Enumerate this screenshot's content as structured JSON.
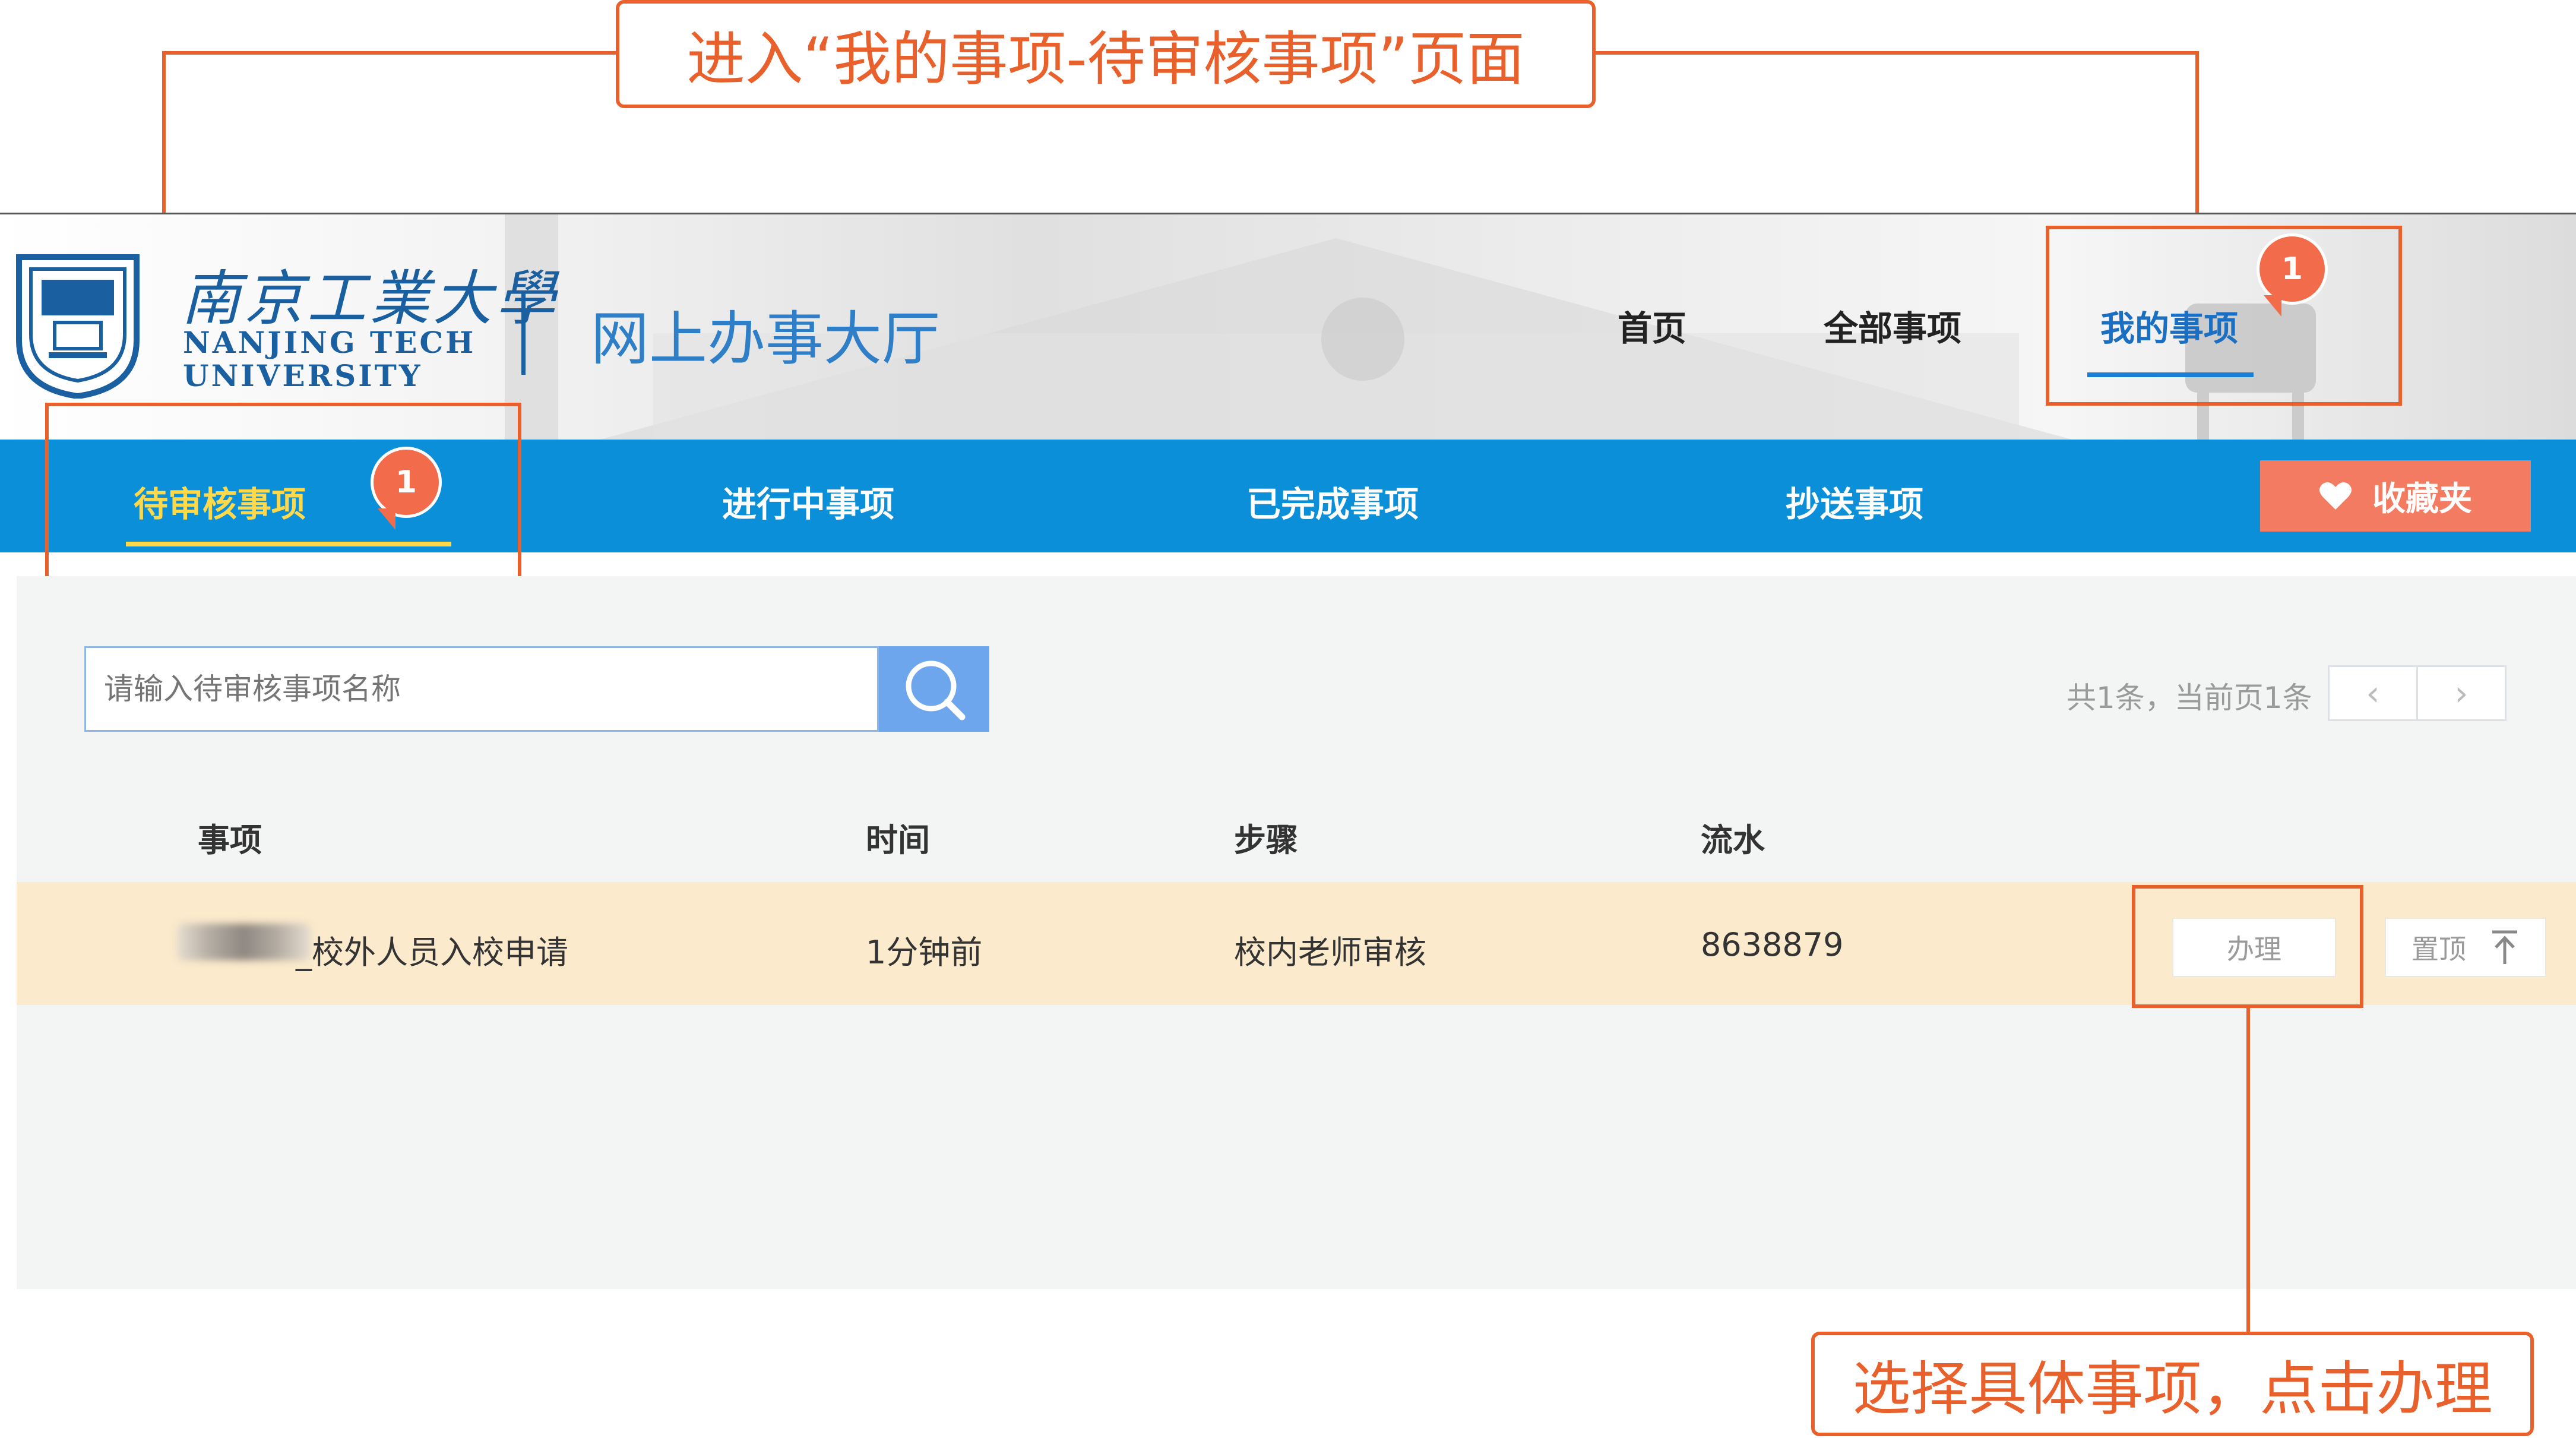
{
  "annotations": {
    "top": "进入“我的事项-待审核事项”页面",
    "bottom": "选择具体事项，点击办理"
  },
  "header": {
    "logo_cn": "南京工業大學",
    "logo_en_line1": "NANJING TECH",
    "logo_en_line2": "UNIVERSITY",
    "hall_title": "网上办事大厅",
    "nav": [
      {
        "label": "首页"
      },
      {
        "label": "全部事项"
      },
      {
        "label": "我的事项",
        "badge": "1",
        "active": true
      }
    ]
  },
  "subnav": {
    "items": [
      {
        "label": "待审核事项",
        "badge": "1",
        "active": true
      },
      {
        "label": "进行中事项"
      },
      {
        "label": "已完成事项"
      },
      {
        "label": "抄送事项"
      }
    ],
    "favorites_label": "收藏夹"
  },
  "search": {
    "placeholder": "请输入待审核事项名称"
  },
  "pagination": {
    "info": "共1条，当前页1条",
    "prev": "‹",
    "next": "›"
  },
  "table": {
    "columns": [
      "事项",
      "时间",
      "步骤",
      "流水"
    ],
    "rows": [
      {
        "item": "_校外人员入校申请",
        "time": "1分钟前",
        "step": "校内老师审核",
        "serial": "8638879",
        "action": "办理",
        "pin": "置顶"
      }
    ]
  },
  "colors": {
    "accent_orange": "#e8612c",
    "subnav_blue": "#0a8fd8",
    "active_yellow": "#ffd94a",
    "favorites_red": "#f37b62",
    "row_highlight": "#fbeacb"
  }
}
